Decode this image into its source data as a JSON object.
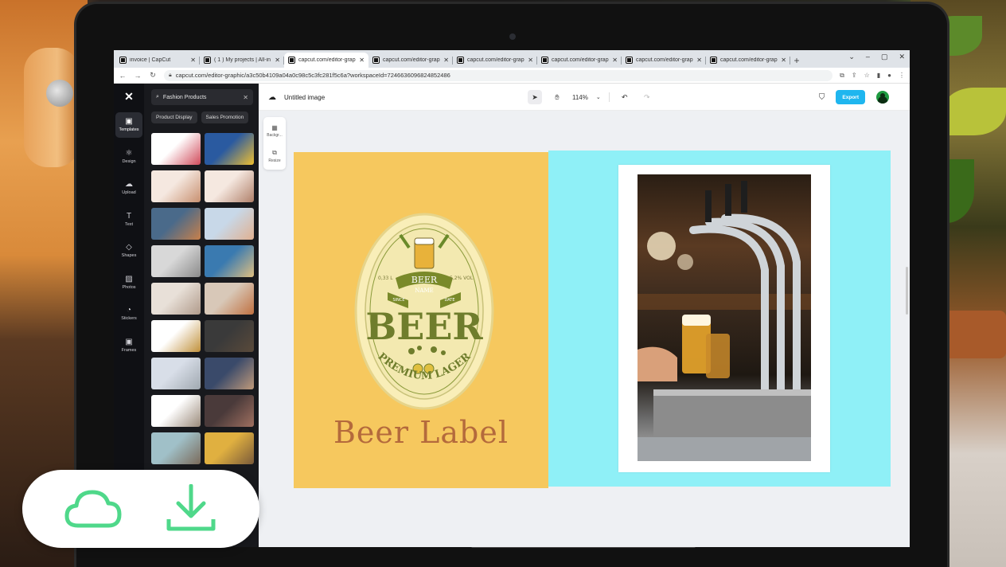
{
  "browser": {
    "tabs": [
      {
        "label": "invoice | CapCut",
        "active": false
      },
      {
        "label": "( 1 ) My projects | All-in",
        "active": false
      },
      {
        "label": "capcut.com/editor-grap",
        "active": true
      },
      {
        "label": "capcut.com/editor-grap",
        "active": false
      },
      {
        "label": "capcut.com/editor-grap",
        "active": false
      },
      {
        "label": "capcut.com/editor-grap",
        "active": false
      },
      {
        "label": "capcut.com/editor-grap",
        "active": false
      },
      {
        "label": "capcut.com/editor-grap",
        "active": false
      }
    ],
    "new_tab": "+",
    "window_controls": [
      "⌄",
      "–",
      "▢",
      "✕"
    ],
    "url": "capcut.com/editor-graphic/a3c50b4109a04a0c98c5c3fc281f5c6a?workspaceId=7246636096824852486"
  },
  "rail": {
    "items": [
      {
        "label": "Templates",
        "icon": "templates-icon",
        "glyph": "▣",
        "active": true
      },
      {
        "label": "Design",
        "icon": "design-icon",
        "glyph": "⚛"
      },
      {
        "label": "Upload",
        "icon": "upload-icon",
        "glyph": "☁"
      },
      {
        "label": "Text",
        "icon": "text-icon",
        "glyph": "T"
      },
      {
        "label": "Shapes",
        "icon": "shapes-icon",
        "glyph": "◇"
      },
      {
        "label": "Photos",
        "icon": "photos-icon",
        "glyph": "▨"
      },
      {
        "label": "Stickers",
        "icon": "stickers-icon",
        "glyph": "◔"
      },
      {
        "label": "Frames",
        "icon": "frames-icon",
        "glyph": "▣"
      }
    ]
  },
  "panel": {
    "search_value": "Fashion Products",
    "chips": [
      "Product Display",
      "Sales Promotion"
    ],
    "thumbnails": [
      {
        "colors": [
          "#ffffff",
          "#d04a5a"
        ]
      },
      {
        "colors": [
          "#2a5aa0",
          "#f0c030"
        ]
      },
      {
        "colors": [
          "#f5e8e0",
          "#c89070"
        ]
      },
      {
        "colors": [
          "#f5e8e0",
          "#b0806a"
        ]
      },
      {
        "colors": [
          "#4a6a8a",
          "#c8804a"
        ]
      },
      {
        "colors": [
          "#c8d8e8",
          "#e0b090"
        ]
      },
      {
        "colors": [
          "#d8d8d8",
          "#8a8a8a"
        ]
      },
      {
        "colors": [
          "#3a7ab0",
          "#e0c080"
        ]
      },
      {
        "colors": [
          "#e8e0d8",
          "#b09a8a"
        ]
      },
      {
        "colors": [
          "#d8c8b8",
          "#c07040"
        ]
      },
      {
        "colors": [
          "#ffffff",
          "#c0903a"
        ]
      },
      {
        "colors": [
          "#3a3a3a",
          "#5a4a3a"
        ]
      },
      {
        "colors": [
          "#d8dee8",
          "#a0a8b0"
        ]
      },
      {
        "colors": [
          "#3a4a6a",
          "#c09a7a"
        ]
      },
      {
        "colors": [
          "#ffffff",
          "#9a8a7a"
        ]
      },
      {
        "colors": [
          "#4a3a3a",
          "#a07060"
        ]
      },
      {
        "colors": [
          "#a0c0c8",
          "#7a6a5a"
        ]
      },
      {
        "colors": [
          "#e0b040",
          "#7a5a3a"
        ]
      }
    ]
  },
  "toolbar": {
    "doc_title": "Untitled image",
    "zoom": "114%",
    "export_label": "Export"
  },
  "sidetools": [
    {
      "label": "Backgr...",
      "icon": "background-icon"
    },
    {
      "label": "Resize",
      "icon": "resize-icon"
    }
  ],
  "design": {
    "left_bg": "#f6c85e",
    "right_bg": "#8ff0f7",
    "label_text": {
      "title": "BEER",
      "badge": "BEER",
      "badge_sub": "NAME",
      "since": "SINCE",
      "date": "DATE",
      "vol_left": "0,33 L",
      "vol_right": "5,2% VOL",
      "premium": "PREMIUM LAGER"
    },
    "caption": "Beer Label"
  }
}
